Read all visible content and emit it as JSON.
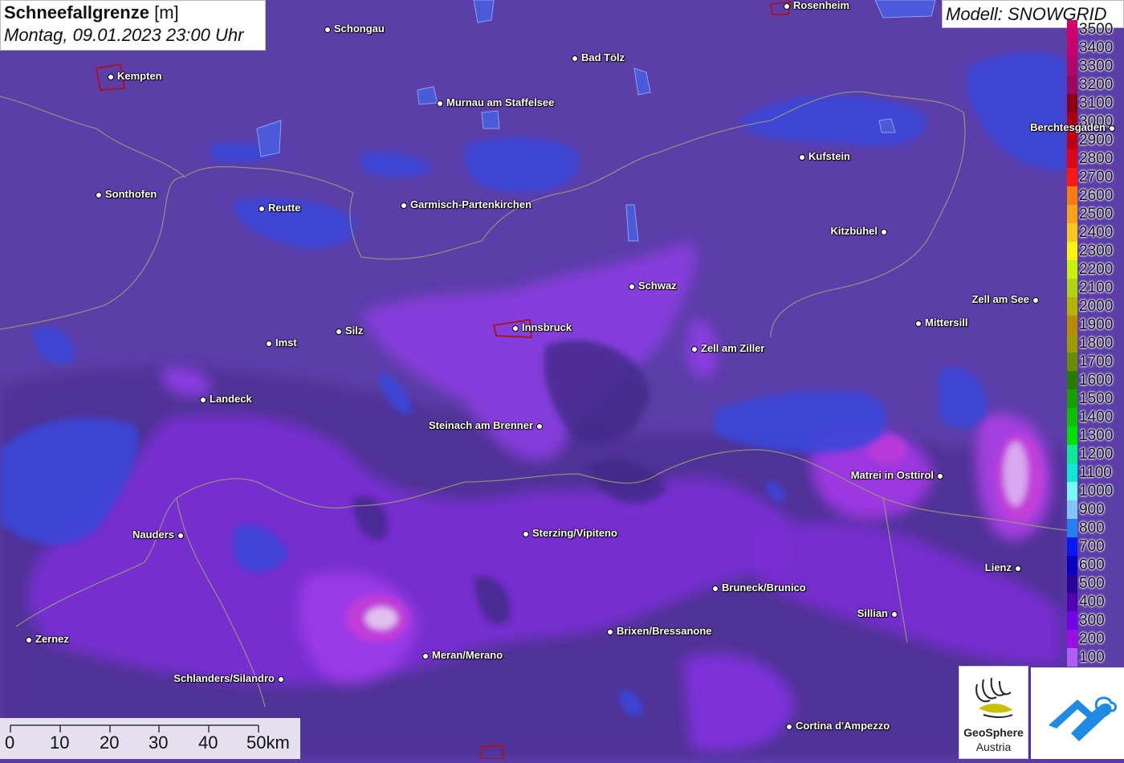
{
  "title": {
    "main": "Schneefallgrenze",
    "unit": "[m]",
    "datetime": "Montag, 09.01.2023 23:00 Uhr"
  },
  "model": "Modell: SNOWGRID",
  "legend": [
    {
      "label": "3500",
      "color": "#d4006a"
    },
    {
      "label": "3400",
      "color": "#c8006e"
    },
    {
      "label": "3300",
      "color": "#b00868"
    },
    {
      "label": "3200",
      "color": "#9a0860"
    },
    {
      "label": "3100",
      "color": "#8a0010"
    },
    {
      "label": "3000",
      "color": "#a80010"
    },
    {
      "label": "2900",
      "color": "#c00010"
    },
    {
      "label": "2800",
      "color": "#dc0818"
    },
    {
      "label": "2700",
      "color": "#f81818"
    },
    {
      "label": "2600",
      "color": "#f87c10"
    },
    {
      "label": "2500",
      "color": "#f8a418"
    },
    {
      "label": "2400",
      "color": "#f8c820"
    },
    {
      "label": "2300",
      "color": "#f8f410"
    },
    {
      "label": "2200",
      "color": "#c8f010"
    },
    {
      "label": "2100",
      "color": "#b0d410"
    },
    {
      "label": "2000",
      "color": "#b4b400"
    },
    {
      "label": "1900",
      "color": "#b88c00"
    },
    {
      "label": "1800",
      "color": "#9c9c00"
    },
    {
      "label": "1700",
      "color": "#6c8c00"
    },
    {
      "label": "1600",
      "color": "#287c00"
    },
    {
      "label": "1500",
      "color": "#18a000"
    },
    {
      "label": "1400",
      "color": "#10c000"
    },
    {
      "label": "1300",
      "color": "#00e000"
    },
    {
      "label": "1200",
      "color": "#10e898"
    },
    {
      "label": "1100",
      "color": "#10e8d0"
    },
    {
      "label": "1000",
      "color": "#78f8f8"
    },
    {
      "label": "900",
      "color": "#80c4f8"
    },
    {
      "label": "800",
      "color": "#2480f0"
    },
    {
      "label": "700",
      "color": "#0818f0"
    },
    {
      "label": "600",
      "color": "#0800c0"
    },
    {
      "label": "500",
      "color": "#280098"
    },
    {
      "label": "400",
      "color": "#5000b0"
    },
    {
      "label": "300",
      "color": "#7000e8"
    },
    {
      "label": "200",
      "color": "#9c10e8"
    },
    {
      "label": "100",
      "color": "#b060f0"
    }
  ],
  "cities": [
    {
      "name": "Rosenheim"
    },
    {
      "name": "Schongau"
    },
    {
      "name": "Kempten"
    },
    {
      "name": "Bad Tölz"
    },
    {
      "name": "Murnau am Staffelsee"
    },
    {
      "name": "Berchtesgaden"
    },
    {
      "name": "Kufstein"
    },
    {
      "name": "Sonthofen"
    },
    {
      "name": "Reutte"
    },
    {
      "name": "Garmisch-Partenkirchen"
    },
    {
      "name": "Kitzbühel"
    },
    {
      "name": "Schwaz"
    },
    {
      "name": "Zell am See"
    },
    {
      "name": "Mittersill"
    },
    {
      "name": "Silz"
    },
    {
      "name": "Innsbruck"
    },
    {
      "name": "Imst"
    },
    {
      "name": "Zell am Ziller"
    },
    {
      "name": "Landeck"
    },
    {
      "name": "Steinach am Brenner"
    },
    {
      "name": "Matrei in Osttirol"
    },
    {
      "name": "Nauders"
    },
    {
      "name": "Sterzing/Vipiteno"
    },
    {
      "name": "Lienz"
    },
    {
      "name": "Bruneck/Brunico"
    },
    {
      "name": "Sillian"
    },
    {
      "name": "Brixen/Bressanone"
    },
    {
      "name": "Zernez"
    },
    {
      "name": "Meran/Merano"
    },
    {
      "name": "Schlanders/Silandro"
    },
    {
      "name": "Cortina d'Ampezzo"
    }
  ],
  "scale_bar": {
    "labels": [
      "0",
      "10",
      "20",
      "30",
      "40",
      "50km"
    ]
  },
  "logos": {
    "geosphere_line1": "GeoSphere",
    "geosphere_line2": "Austria"
  }
}
